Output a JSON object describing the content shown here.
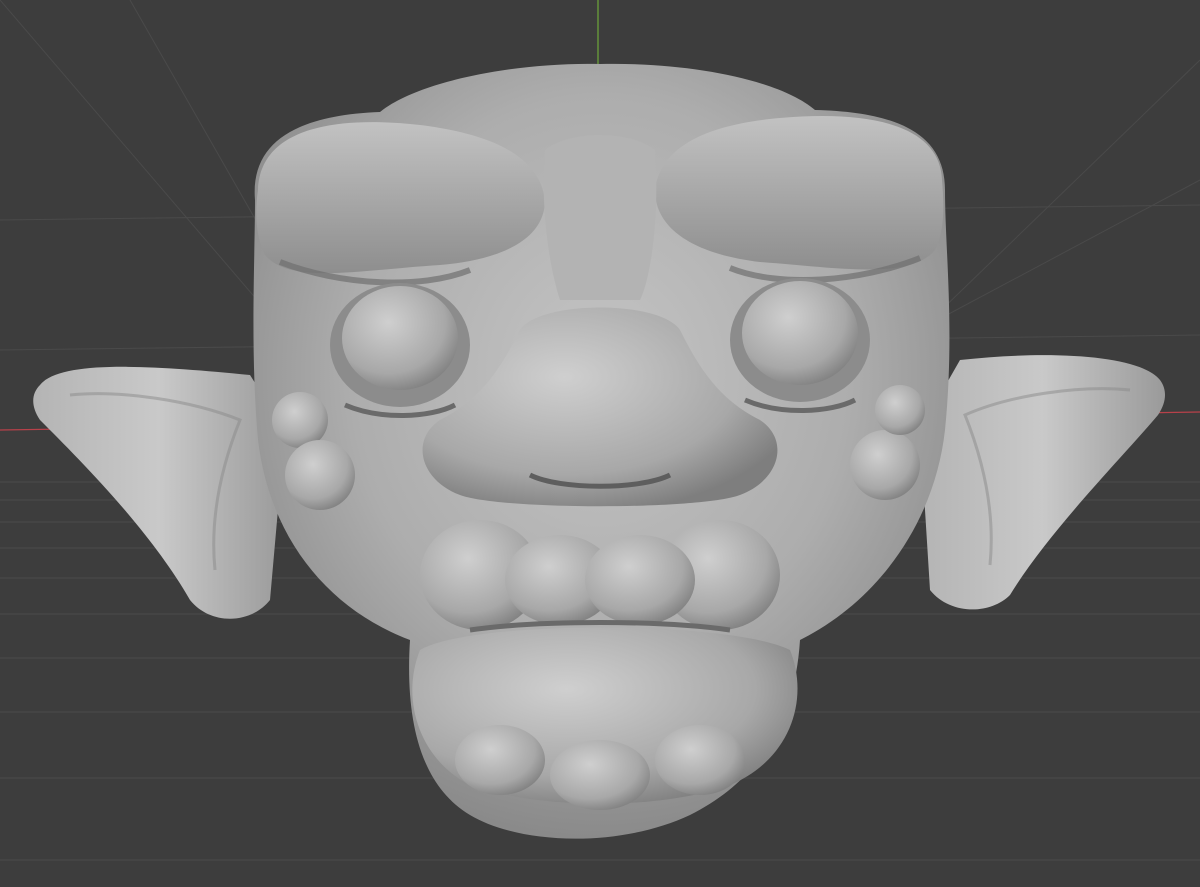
{
  "viewport": {
    "background_color": "#3d3d3d",
    "grid_color": "#4a4a4a",
    "x_axis_color": "#b8414a",
    "z_axis_color": "#6fa83a",
    "mesh_color": "#a9a9a9"
  }
}
